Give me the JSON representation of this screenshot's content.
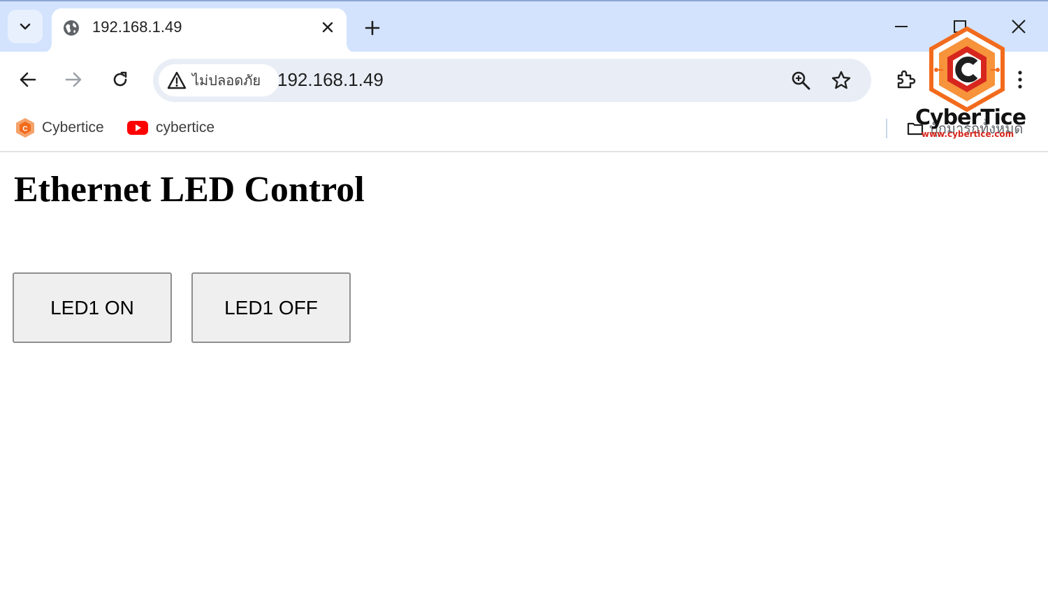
{
  "browser": {
    "tab": {
      "title": "192.168.1.49"
    },
    "address_bar": {
      "security_label": "ไม่ปลอดภัย",
      "url": "192.168.1.49"
    },
    "bookmarks": [
      {
        "label": "Cybertice",
        "icon": "cybertice-favicon"
      },
      {
        "label": "cybertice",
        "icon": "youtube-icon"
      }
    ],
    "all_bookmarks_label": "บุ๊กมาร์กทั้งหมด"
  },
  "page": {
    "title": "Ethernet LED Control",
    "buttons": [
      {
        "label": "LED1 ON"
      },
      {
        "label": "LED1 OFF"
      }
    ]
  },
  "watermark": {
    "brand": "CyberTice",
    "url": "www.cybertice.com"
  },
  "colors": {
    "tabstrip": "#d3e3fd",
    "omnibox": "#e9eef6",
    "button_bg": "#efefef",
    "brand_orange": "#f26b1d",
    "brand_red": "#d7261e"
  }
}
